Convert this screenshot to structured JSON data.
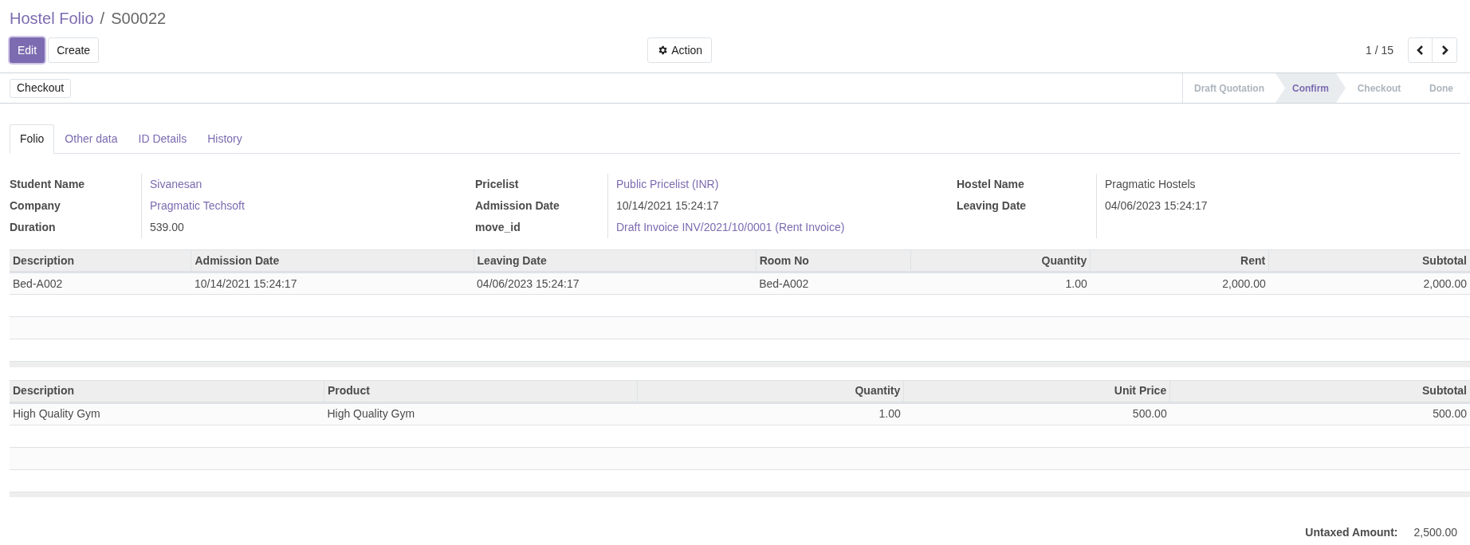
{
  "breadcrumb": {
    "parent": "Hostel Folio",
    "separator": "/",
    "current": "S00022"
  },
  "buttons": {
    "edit": "Edit",
    "create": "Create",
    "action": "Action"
  },
  "pager": {
    "text": "1 / 15"
  },
  "header_buttons": [
    "Checkout"
  ],
  "stages": [
    {
      "label": "Draft Quotation",
      "selected": false
    },
    {
      "label": "Confirm",
      "selected": true
    },
    {
      "label": "Checkout",
      "selected": false
    },
    {
      "label": "Done",
      "selected": false
    }
  ],
  "tabs": [
    {
      "label": "Folio",
      "selected": true
    },
    {
      "label": "Other data",
      "selected": false
    },
    {
      "label": "ID Details",
      "selected": false
    },
    {
      "label": "History",
      "selected": false
    }
  ],
  "field_groups": [
    [
      {
        "label": "Student Name",
        "value": "Sivanesan",
        "kind": "link"
      },
      {
        "label": "Company",
        "value": "Pragmatic Techsoft",
        "kind": "link"
      },
      {
        "label": "Duration",
        "value": "539.00",
        "kind": "text"
      }
    ],
    [
      {
        "label": "Pricelist",
        "value": "Public Pricelist (INR)",
        "kind": "link"
      },
      {
        "label": "Admission Date",
        "value": "10/14/2021 15:24:17",
        "kind": "text"
      },
      {
        "label": "move_id",
        "value": "Draft Invoice INV/2021/10/0001 (Rent Invoice)",
        "kind": "link"
      }
    ],
    [
      {
        "label": "Hostel Name",
        "value": "Pragmatic Hostels",
        "kind": "text"
      },
      {
        "label": "Leaving Date",
        "value": "04/06/2023 15:24:17",
        "kind": "text"
      }
    ]
  ],
  "tables": [
    {
      "columns": [
        {
          "label": "Description",
          "kind": "text"
        },
        {
          "label": "Admission Date",
          "kind": "text"
        },
        {
          "label": "Leaving Date",
          "kind": "text"
        },
        {
          "label": "Room No",
          "kind": "text"
        },
        {
          "label": "Quantity",
          "kind": "number"
        },
        {
          "label": "Rent",
          "kind": "number"
        },
        {
          "label": "Subtotal",
          "kind": "number"
        }
      ],
      "rows": [
        [
          "Bed-A002",
          "10/14/2021 15:24:17",
          "04/06/2023 15:24:17",
          "Bed-A002",
          "1.00",
          "2,000.00",
          "2,000.00"
        ]
      ]
    },
    {
      "columns": [
        {
          "label": "Description",
          "kind": "text"
        },
        {
          "label": "Product",
          "kind": "text"
        },
        {
          "label": "Quantity",
          "kind": "number"
        },
        {
          "label": "Unit Price",
          "kind": "number"
        },
        {
          "label": "Subtotal",
          "kind": "number"
        }
      ],
      "rows": [
        [
          "High Quality Gym",
          "High Quality Gym",
          "1.00",
          "500.00",
          "500.00"
        ]
      ]
    }
  ],
  "totals": [
    {
      "label": "Untaxed Amount:",
      "value": "2,500.00"
    }
  ]
}
